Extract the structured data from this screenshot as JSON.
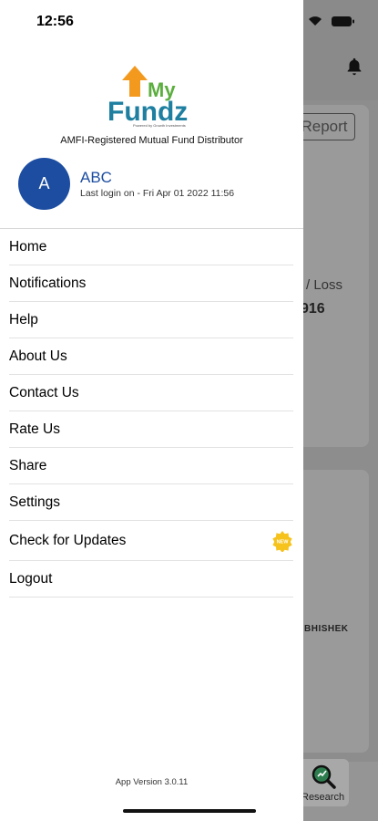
{
  "status_bar": {
    "time": "12:56"
  },
  "brand": {
    "logo_text_my": "My",
    "logo_text_fundz": "Fundz",
    "logo_powered": "Powered by Growth Investments",
    "tagline": "AMFI-Registered Mutual Fund Distributor"
  },
  "user": {
    "avatar_initial": "A",
    "name": "ABC",
    "last_login": "Last login on - Fri Apr 01 2022 11:56"
  },
  "menu": {
    "items": [
      {
        "label": "Home"
      },
      {
        "label": "Notifications"
      },
      {
        "label": "Help"
      },
      {
        "label": "About Us"
      },
      {
        "label": "Contact Us"
      },
      {
        "label": "Rate Us"
      },
      {
        "label": "Share"
      },
      {
        "label": "Settings"
      },
      {
        "label": "Check for Updates",
        "badge": "NEW"
      },
      {
        "label": "Logout"
      }
    ]
  },
  "footer": {
    "app_version": "App Version 3.0.11"
  },
  "background": {
    "report_button": "Report",
    "loss_label": "/ Loss",
    "value": "916",
    "name_fragment": "BHISHEK",
    "research_tab": "Research"
  },
  "colors": {
    "avatar_bg": "#1c4da1",
    "user_name": "#1c4da1",
    "logo_orange": "#f39a1e",
    "logo_teal": "#1e7fa0",
    "logo_green": "#5cae3f",
    "badge": "#f6c21c"
  }
}
